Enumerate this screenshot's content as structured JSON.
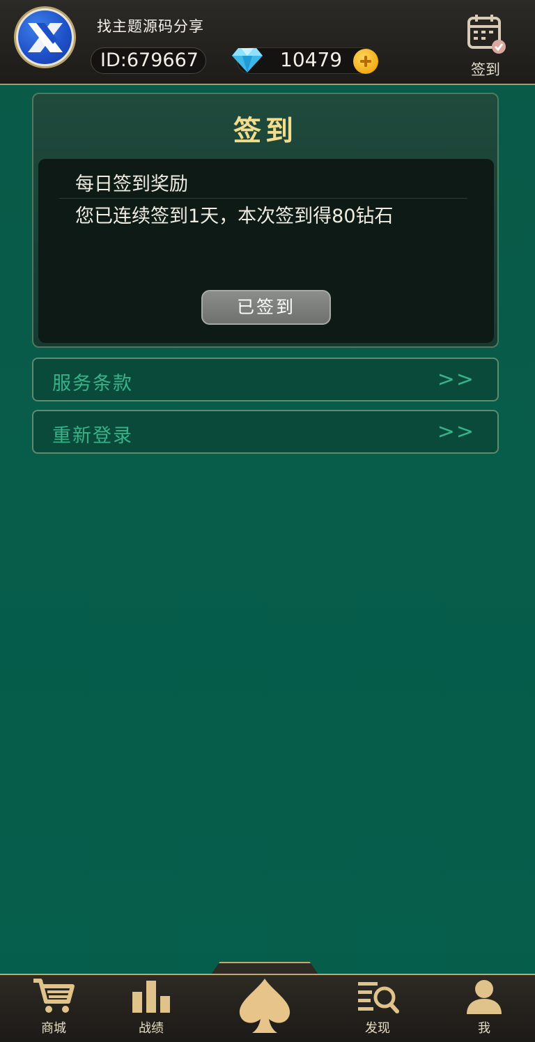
{
  "header": {
    "username": "找主题源码分享",
    "id_text": "ID:679667",
    "diamonds": "10479",
    "signin_label": "签到"
  },
  "card": {
    "title": "签到",
    "reward_title": "每日签到奖励",
    "reward_desc": "您已连续签到1天，本次签到得80钻石",
    "button_label": "已签到"
  },
  "rows": [
    {
      "label": "服务条款",
      "arrow": ">>"
    },
    {
      "label": "重新登录",
      "arrow": ">>"
    }
  ],
  "nav": {
    "shop": "商城",
    "records": "战绩",
    "discover": "发现",
    "me": "我"
  },
  "colors": {
    "background": "#075c4a",
    "accent_green": "#38b287",
    "title_gold": "#f2dc8d",
    "nav_gold": "#c3a96e"
  },
  "icons": [
    "logo-icon",
    "diamond-icon",
    "plus-icon",
    "calendar-check-icon",
    "cart-icon",
    "bar-chart-icon",
    "spade-icon",
    "search-list-icon",
    "user-icon"
  ]
}
